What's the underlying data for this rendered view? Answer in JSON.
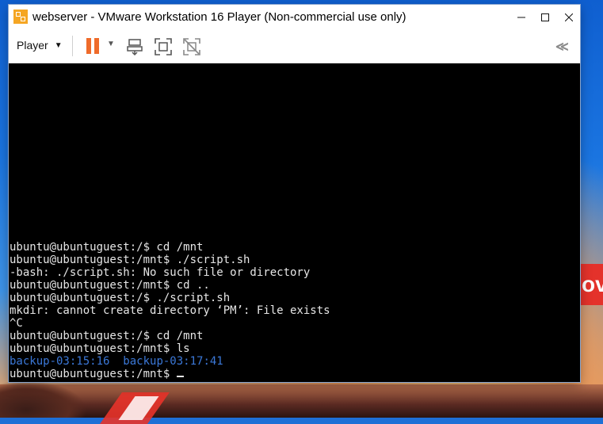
{
  "window": {
    "title": "webserver - VMware Workstation 16 Player (Non-commercial use only)"
  },
  "toolbar": {
    "player_label": "Player",
    "icons": [
      "pause-icon",
      "send-ctrl-alt-del-icon",
      "fullscreen-icon",
      "unity-icon",
      "collapse-icon"
    ]
  },
  "console": {
    "lines": [
      "ubuntu@ubuntuguest:/$ cd /mnt",
      "ubuntu@ubuntuguest:/mnt$ ./script.sh",
      "-bash: ./script.sh: No such file or directory",
      "ubuntu@ubuntuguest:/mnt$ cd ..",
      "ubuntu@ubuntuguest:/$ ./script.sh",
      "mkdir: cannot create directory ‘PM’: File exists",
      "^C",
      "ubuntu@ubuntuguest:/$ cd /mnt",
      "ubuntu@ubuntuguest:/mnt$ ls"
    ],
    "ls_output": [
      "backup-03:15:16",
      "backup-03:17:41"
    ],
    "prompt": "ubuntu@ubuntuguest:/mnt$ "
  },
  "desktop": {
    "promo_text": "ov"
  },
  "colors": {
    "pause_accent": "#ef6b2a",
    "directory_blue": "#3b78d8",
    "console_bg": "#000000"
  }
}
